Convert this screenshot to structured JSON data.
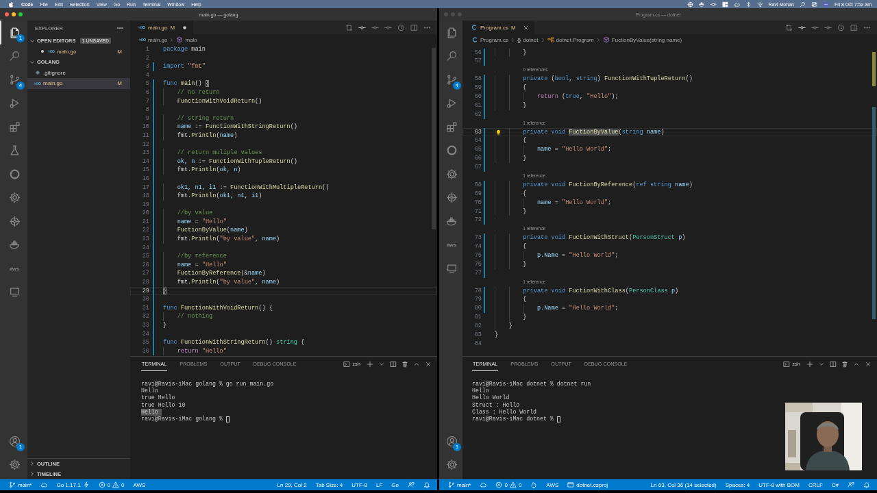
{
  "menubar": {
    "app": "Code",
    "menus": [
      "File",
      "Edit",
      "Selection",
      "View",
      "Go",
      "Run",
      "Terminal",
      "Window",
      "Help"
    ],
    "user": "Ravi Mohan",
    "clock": "Fri 8 Oct 7:52 am"
  },
  "windows": [
    {
      "title": "main.go — golang",
      "active": true,
      "activity": [
        {
          "kind": "files",
          "selected": true,
          "badge": "1"
        },
        {
          "kind": "search",
          "selected": false
        },
        {
          "kind": "scm",
          "selected": false,
          "badge": "4"
        },
        {
          "kind": "debug",
          "selected": false
        },
        {
          "kind": "extensions",
          "selected": false
        },
        {
          "kind": "flask",
          "selected": false
        },
        {
          "kind": "ring",
          "selected": false
        },
        {
          "kind": "gear",
          "selected": false
        },
        {
          "kind": "helm",
          "selected": false
        },
        {
          "kind": "whale",
          "selected": false
        },
        {
          "kind": "aws",
          "label": "aws",
          "selected": false
        },
        {
          "kind": "monitor",
          "selected": false
        }
      ],
      "activity_bottom": [
        {
          "kind": "account",
          "selected": false,
          "badge": "1"
        },
        {
          "kind": "settings",
          "selected": false
        }
      ],
      "sidebar": {
        "title": "EXPLORER",
        "sections": [
          {
            "title": "OPEN EDITORS",
            "expanded": true,
            "badge": "1 UNSAVED",
            "items": [
              {
                "name": "main.go",
                "kind": "go-file",
                "git_status": "M",
                "dirty": true,
                "selected": false
              }
            ]
          },
          {
            "title": "GOLANG",
            "expanded": true,
            "items": [
              {
                "name": ".gitignore",
                "kind": "gitignore",
                "selected": false
              },
              {
                "name": "main.go",
                "kind": "go-file",
                "git_status": "M",
                "selected": true
              }
            ]
          },
          {
            "title": "OUTLINE",
            "expanded": false
          },
          {
            "title": "TIMELINE",
            "expanded": false
          }
        ]
      },
      "editor": {
        "tabs": [
          {
            "label": "main.go",
            "kind": "go-file",
            "git_status": "M",
            "dirty": true,
            "selected": true
          }
        ],
        "breadcrumbs": [
          {
            "kind": "go-file",
            "text": "main.go"
          },
          {
            "kind": "method",
            "text": "main"
          }
        ],
        "lines": [
          {
            "number": "1",
            "changed": false,
            "current": false,
            "tokens": [
              {
                "text": "package",
                "kind": "kw"
              },
              {
                "text": " main",
                "kind": "plain"
              }
            ]
          },
          {
            "number": "2",
            "changed": false,
            "current": false
          },
          {
            "number": "3",
            "changed": true,
            "current": false,
            "tokens": [
              {
                "text": "import",
                "kind": "kw"
              },
              {
                "text": " \"fmt\"",
                "kind": "str"
              }
            ]
          },
          {
            "number": "4",
            "changed": false,
            "current": false
          },
          {
            "number": "5",
            "changed": true,
            "current": false,
            "tokens": [
              {
                "text": "func",
                "kind": "kw"
              },
              {
                "text": " main",
                "kind": "fn"
              },
              {
                "text": "() ",
                "kind": "plain"
              },
              {
                "text": "{",
                "kind": "brace"
              }
            ]
          },
          {
            "number": "6",
            "changed": true,
            "current": false,
            "tokens": [
              {
                "text": "    // no return",
                "kind": "com"
              }
            ]
          },
          {
            "number": "7",
            "changed": true,
            "current": false,
            "tokens": [
              {
                "text": "    FunctionWithVoidReturn",
                "kind": "fn"
              },
              {
                "text": "()",
                "kind": "plain"
              }
            ]
          },
          {
            "number": "8",
            "changed": true,
            "current": false
          },
          {
            "number": "9",
            "changed": true,
            "current": false,
            "tokens": [
              {
                "text": "    // string return",
                "kind": "com"
              }
            ]
          },
          {
            "number": "10",
            "changed": true,
            "current": false,
            "tokens": [
              {
                "text": "    name",
                "kind": "var"
              },
              {
                "text": " := ",
                "kind": "plain"
              },
              {
                "text": "FunctionWithStringReturn",
                "kind": "fn"
              },
              {
                "text": "()",
                "kind": "plain"
              }
            ]
          },
          {
            "number": "11",
            "changed": true,
            "current": false,
            "tokens": [
              {
                "text": "    fmt.",
                "kind": "plain"
              },
              {
                "text": "Println",
                "kind": "fn"
              },
              {
                "text": "(",
                "kind": "plain"
              },
              {
                "text": "name",
                "kind": "var"
              },
              {
                "text": ")",
                "kind": "plain"
              }
            ]
          },
          {
            "number": "12",
            "changed": true,
            "current": false
          },
          {
            "number": "13",
            "changed": true,
            "current": false,
            "tokens": [
              {
                "text": "    // return muliple values",
                "kind": "com"
              }
            ]
          },
          {
            "number": "14",
            "changed": true,
            "current": false,
            "tokens": [
              {
                "text": "    ok, n",
                "kind": "var"
              },
              {
                "text": " := ",
                "kind": "plain"
              },
              {
                "text": "FunctionWithTupleReturn",
                "kind": "fn"
              },
              {
                "text": "()",
                "kind": "plain"
              }
            ]
          },
          {
            "number": "15",
            "changed": true,
            "current": false,
            "tokens": [
              {
                "text": "    fmt.",
                "kind": "plain"
              },
              {
                "text": "Println",
                "kind": "fn"
              },
              {
                "text": "(",
                "kind": "plain"
              },
              {
                "text": "ok, n",
                "kind": "var"
              },
              {
                "text": ")",
                "kind": "plain"
              }
            ]
          },
          {
            "number": "16",
            "changed": true,
            "current": false
          },
          {
            "number": "17",
            "changed": true,
            "current": false,
            "tokens": [
              {
                "text": "    ok1, n1, i1",
                "kind": "var"
              },
              {
                "text": " := ",
                "kind": "plain"
              },
              {
                "text": "FunctionWithMultipleReturn",
                "kind": "fn"
              },
              {
                "text": "()",
                "kind": "plain"
              }
            ]
          },
          {
            "number": "18",
            "changed": true,
            "current": false,
            "tokens": [
              {
                "text": "    fmt.",
                "kind": "plain"
              },
              {
                "text": "Println",
                "kind": "fn"
              },
              {
                "text": "(",
                "kind": "plain"
              },
              {
                "text": "ok1, n1, i1",
                "kind": "var"
              },
              {
                "text": ")",
                "kind": "plain"
              }
            ]
          },
          {
            "number": "19",
            "changed": true,
            "current": false
          },
          {
            "number": "20",
            "changed": true,
            "current": false,
            "tokens": [
              {
                "text": "    //by value",
                "kind": "com"
              }
            ]
          },
          {
            "number": "21",
            "changed": true,
            "current": false,
            "tokens": [
              {
                "text": "    name",
                "kind": "var"
              },
              {
                "text": " = ",
                "kind": "plain"
              },
              {
                "text": "\"Hello\"",
                "kind": "str"
              }
            ]
          },
          {
            "number": "22",
            "changed": true,
            "current": false,
            "tokens": [
              {
                "text": "    FuctionByValue",
                "kind": "fn"
              },
              {
                "text": "(",
                "kind": "plain"
              },
              {
                "text": "name",
                "kind": "var"
              },
              {
                "text": ")",
                "kind": "plain"
              }
            ]
          },
          {
            "number": "23",
            "changed": true,
            "current": false,
            "tokens": [
              {
                "text": "    fmt.",
                "kind": "plain"
              },
              {
                "text": "Println",
                "kind": "fn"
              },
              {
                "text": "(",
                "kind": "plain"
              },
              {
                "text": "\"by value\"",
                "kind": "str"
              },
              {
                "text": ", ",
                "kind": "plain"
              },
              {
                "text": "name",
                "kind": "var"
              },
              {
                "text": ")",
                "kind": "plain"
              }
            ]
          },
          {
            "number": "24",
            "changed": true,
            "current": false
          },
          {
            "number": "25",
            "changed": true,
            "current": false,
            "tokens": [
              {
                "text": "    //by reference",
                "kind": "com"
              }
            ]
          },
          {
            "number": "26",
            "changed": true,
            "current": false,
            "tokens": [
              {
                "text": "    name",
                "kind": "var"
              },
              {
                "text": " = ",
                "kind": "plain"
              },
              {
                "text": "\"Hello\"",
                "kind": "str"
              }
            ]
          },
          {
            "number": "27",
            "changed": true,
            "current": false,
            "tokens": [
              {
                "text": "    FuctionByReference",
                "kind": "fn"
              },
              {
                "text": "(&",
                "kind": "plain"
              },
              {
                "text": "name",
                "kind": "var"
              },
              {
                "text": ")",
                "kind": "plain"
              }
            ]
          },
          {
            "number": "28",
            "changed": true,
            "current": false,
            "tokens": [
              {
                "text": "    fmt.",
                "kind": "plain"
              },
              {
                "text": "Println",
                "kind": "fn"
              },
              {
                "text": "(",
                "kind": "plain"
              },
              {
                "text": "\"by value\"",
                "kind": "str"
              },
              {
                "text": ", ",
                "kind": "plain"
              },
              {
                "text": "name",
                "kind": "var"
              },
              {
                "text": ")",
                "kind": "plain"
              }
            ]
          },
          {
            "number": "29",
            "changed": true,
            "current": true,
            "tokens": [
              {
                "text": "}",
                "kind": "brace"
              }
            ]
          },
          {
            "number": "30",
            "changed": true,
            "current": false
          },
          {
            "number": "31",
            "changed": true,
            "current": false,
            "tokens": [
              {
                "text": "func",
                "kind": "kw"
              },
              {
                "text": " FunctionWithVoidReturn",
                "kind": "fn"
              },
              {
                "text": "() {",
                "kind": "plain"
              }
            ]
          },
          {
            "number": "32",
            "changed": true,
            "current": false,
            "tokens": [
              {
                "text": "    // nothing",
                "kind": "com"
              }
            ]
          },
          {
            "number": "33",
            "changed": true,
            "current": false,
            "tokens": [
              {
                "text": "}",
                "kind": "plain"
              }
            ]
          },
          {
            "number": "34",
            "changed": true,
            "current": false
          },
          {
            "number": "35",
            "changed": true,
            "current": false,
            "tokens": [
              {
                "text": "func",
                "kind": "kw"
              },
              {
                "text": " FunctionWithStringReturn",
                "kind": "fn"
              },
              {
                "text": "() ",
                "kind": "plain"
              },
              {
                "text": "string",
                "kind": "type"
              },
              {
                "text": " {",
                "kind": "plain"
              }
            ]
          },
          {
            "number": "36",
            "changed": true,
            "current": false,
            "tokens": [
              {
                "text": "    return",
                "kind": "ctl"
              },
              {
                "text": " \"Hello\"",
                "kind": "str"
              }
            ]
          }
        ]
      },
      "panel": {
        "tabs": [
          {
            "label": "TERMINAL",
            "selected": true
          },
          {
            "label": "PROBLEMS",
            "selected": false
          },
          {
            "label": "OUTPUT",
            "selected": false
          },
          {
            "label": "DEBUG CONSOLE",
            "selected": false
          }
        ],
        "shell": "zsh",
        "lines": [
          {
            "text": "ravi@Ravis-iMac golang % go run main.go",
            "selected": false,
            "cursor": false
          },
          {
            "text": "Hello",
            "selected": false,
            "cursor": false
          },
          {
            "text": "true Hello",
            "selected": false,
            "cursor": false
          },
          {
            "text": "true Hello 10",
            "selected": false,
            "cursor": false
          },
          {
            "text": "Hello",
            "selected": true,
            "cursor": false
          },
          {
            "text": "ravi@Ravis-iMac golang %",
            "selected": false,
            "cursor": true
          }
        ]
      },
      "status_bar": {
        "left": [
          {
            "kind": "branch",
            "text": "main*"
          },
          {
            "kind": "cloud"
          },
          {
            "kind": "go",
            "text": "Go 1.17.1"
          },
          {
            "kind": "problems",
            "errors": "0",
            "warnings": "0"
          },
          {
            "kind": "text",
            "text": "AWS"
          }
        ],
        "right": [
          {
            "kind": "text",
            "text": "Ln 29, Col 2"
          },
          {
            "kind": "text",
            "text": "Tab Size: 4"
          },
          {
            "kind": "text",
            "text": "UTF-8"
          },
          {
            "kind": "text",
            "text": "LF"
          },
          {
            "kind": "text",
            "text": "Go"
          },
          {
            "kind": "feedback"
          },
          {
            "kind": "bell"
          }
        ]
      }
    },
    {
      "title": "Program.cs — dotnet",
      "active": false,
      "activity": [
        {
          "kind": "files",
          "selected": false
        },
        {
          "kind": "search",
          "selected": false
        },
        {
          "kind": "scm",
          "selected": false,
          "badge": "4"
        },
        {
          "kind": "debug",
          "selected": false
        },
        {
          "kind": "extensions",
          "selected": false
        },
        {
          "kind": "ring",
          "selected": false
        },
        {
          "kind": "gear",
          "selected": false
        },
        {
          "kind": "helm",
          "selected": false
        },
        {
          "kind": "whale",
          "selected": false
        },
        {
          "kind": "aws",
          "label": "aws",
          "selected": false
        },
        {
          "kind": "monitor",
          "selected": false
        }
      ],
      "activity_bottom": [
        {
          "kind": "account",
          "selected": false,
          "badge": "1"
        },
        {
          "kind": "settings",
          "selected": false
        }
      ],
      "editor": {
        "tabs": [
          {
            "label": "Program.cs",
            "kind": "cs-file",
            "git_status": "M",
            "dirty": false,
            "selected": true
          }
        ],
        "breadcrumbs": [
          {
            "kind": "cs-file",
            "text": "Program.cs"
          },
          {
            "kind": "namespace",
            "symbol": "{}",
            "text": "dotnet"
          },
          {
            "kind": "class",
            "text": "dotnet.Program"
          },
          {
            "kind": "method",
            "text": "FuctionByValue(string name)"
          }
        ],
        "lightbulb": true,
        "lines": [
          {
            "number": "56",
            "changed": true,
            "current": false,
            "tokens": [
              {
                "text": "        }",
                "kind": "plain"
              }
            ]
          },
          {
            "number": "57",
            "changed": true,
            "current": false
          },
          {
            "number": "58",
            "changed": true,
            "current": false,
            "codelens": "0 references",
            "tokens": [
              {
                "text": "        private",
                "kind": "kw"
              },
              {
                "text": " (",
                "kind": "plain"
              },
              {
                "text": "bool",
                "kind": "kw"
              },
              {
                "text": ", ",
                "kind": "plain"
              },
              {
                "text": "string",
                "kind": "kw"
              },
              {
                "text": ") ",
                "kind": "plain"
              },
              {
                "text": "FunctionWithTupleReturn",
                "kind": "fn"
              },
              {
                "text": "()",
                "kind": "plain"
              }
            ]
          },
          {
            "number": "59",
            "changed": true,
            "current": false,
            "tokens": [
              {
                "text": "        {",
                "kind": "plain"
              }
            ]
          },
          {
            "number": "60",
            "changed": true,
            "current": false,
            "tokens": [
              {
                "text": "            return",
                "kind": "ctl"
              },
              {
                "text": " (",
                "kind": "plain"
              },
              {
                "text": "true",
                "kind": "kw"
              },
              {
                "text": ", ",
                "kind": "plain"
              },
              {
                "text": "\"Hello\"",
                "kind": "str"
              },
              {
                "text": ");",
                "kind": "plain"
              }
            ]
          },
          {
            "number": "61",
            "changed": true,
            "current": false,
            "tokens": [
              {
                "text": "        }",
                "kind": "plain"
              }
            ]
          },
          {
            "number": "62",
            "changed": true,
            "current": false
          },
          {
            "number": "63",
            "changed": true,
            "current": true,
            "codelens": "1 reference",
            "tokens": [
              {
                "text": "        private void ",
                "kind": "kw"
              },
              {
                "text": "FuctionByValue",
                "kind": "selfn"
              },
              {
                "text": "(",
                "kind": "plain"
              },
              {
                "text": "string",
                "kind": "kw"
              },
              {
                "text": " name",
                "kind": "var"
              },
              {
                "text": ")",
                "kind": "plain"
              }
            ]
          },
          {
            "number": "64",
            "changed": true,
            "current": false,
            "tokens": [
              {
                "text": "        {",
                "kind": "plain"
              }
            ]
          },
          {
            "number": "65",
            "changed": true,
            "current": false,
            "tokens": [
              {
                "text": "            name",
                "kind": "var"
              },
              {
                "text": " = ",
                "kind": "plain"
              },
              {
                "text": "\"Hello World\"",
                "kind": "str"
              },
              {
                "text": ";",
                "kind": "plain"
              }
            ]
          },
          {
            "number": "66",
            "changed": true,
            "current": false,
            "tokens": [
              {
                "text": "        }",
                "kind": "plain"
              }
            ]
          },
          {
            "number": "67",
            "changed": true,
            "current": false
          },
          {
            "number": "68",
            "changed": true,
            "current": false,
            "codelens": "1 reference",
            "tokens": [
              {
                "text": "        private void",
                "kind": "kw"
              },
              {
                "text": " FuctionByReference",
                "kind": "fn"
              },
              {
                "text": "(",
                "kind": "plain"
              },
              {
                "text": "ref string",
                "kind": "kw"
              },
              {
                "text": " name",
                "kind": "var"
              },
              {
                "text": ")",
                "kind": "plain"
              }
            ]
          },
          {
            "number": "69",
            "changed": true,
            "current": false,
            "tokens": [
              {
                "text": "        {",
                "kind": "plain"
              }
            ]
          },
          {
            "number": "70",
            "changed": true,
            "current": false,
            "tokens": [
              {
                "text": "            name",
                "kind": "var"
              },
              {
                "text": " = ",
                "kind": "plain"
              },
              {
                "text": "\"Hello World\"",
                "kind": "str"
              },
              {
                "text": ";",
                "kind": "plain"
              }
            ]
          },
          {
            "number": "71",
            "changed": true,
            "current": false,
            "tokens": [
              {
                "text": "        }",
                "kind": "plain"
              }
            ]
          },
          {
            "number": "72",
            "changed": true,
            "current": false
          },
          {
            "number": "73",
            "changed": true,
            "current": false,
            "codelens": "1 reference",
            "tokens": [
              {
                "text": "        private void",
                "kind": "kw"
              },
              {
                "text": " FuctionWithStruct",
                "kind": "fn"
              },
              {
                "text": "(",
                "kind": "plain"
              },
              {
                "text": "PersonStruct",
                "kind": "type"
              },
              {
                "text": " p",
                "kind": "var"
              },
              {
                "text": ")",
                "kind": "plain"
              }
            ]
          },
          {
            "number": "74",
            "changed": true,
            "current": false,
            "tokens": [
              {
                "text": "        {",
                "kind": "plain"
              }
            ]
          },
          {
            "number": "75",
            "changed": true,
            "current": false,
            "tokens": [
              {
                "text": "            p.Name",
                "kind": "var"
              },
              {
                "text": " = ",
                "kind": "plain"
              },
              {
                "text": "\"Hello World\"",
                "kind": "str"
              },
              {
                "text": ";",
                "kind": "plain"
              }
            ]
          },
          {
            "number": "76",
            "changed": true,
            "current": false,
            "tokens": [
              {
                "text": "        }",
                "kind": "plain"
              }
            ]
          },
          {
            "number": "77",
            "changed": true,
            "current": false
          },
          {
            "number": "78",
            "changed": true,
            "current": false,
            "codelens": "1 reference",
            "tokens": [
              {
                "text": "        private void",
                "kind": "kw"
              },
              {
                "text": " FuctionWithClass",
                "kind": "fn"
              },
              {
                "text": "(",
                "kind": "plain"
              },
              {
                "text": "PersonClass",
                "kind": "type"
              },
              {
                "text": " p",
                "kind": "var"
              },
              {
                "text": ")",
                "kind": "plain"
              }
            ]
          },
          {
            "number": "79",
            "changed": true,
            "current": false,
            "tokens": [
              {
                "text": "        {",
                "kind": "plain"
              }
            ]
          },
          {
            "number": "80",
            "changed": true,
            "current": false,
            "tokens": [
              {
                "text": "            p.Name",
                "kind": "var"
              },
              {
                "text": " = ",
                "kind": "plain"
              },
              {
                "text": "\"Hello World\"",
                "kind": "str"
              },
              {
                "text": ";",
                "kind": "plain"
              }
            ]
          },
          {
            "number": "81",
            "changed": false,
            "current": false,
            "tokens": [
              {
                "text": "        }",
                "kind": "plain"
              }
            ]
          },
          {
            "number": "82",
            "changed": false,
            "current": false,
            "tokens": [
              {
                "text": "    }",
                "kind": "plain"
              }
            ]
          },
          {
            "number": "83",
            "changed": false,
            "current": false,
            "tokens": [
              {
                "text": "}",
                "kind": "plain"
              }
            ]
          },
          {
            "number": "84",
            "changed": false,
            "current": false
          }
        ]
      },
      "panel": {
        "tabs": [
          {
            "label": "TERMINAL",
            "selected": true
          },
          {
            "label": "PROBLEMS",
            "selected": false
          },
          {
            "label": "OUTPUT",
            "selected": false
          },
          {
            "label": "DEBUG CONSOLE",
            "selected": false
          }
        ],
        "shell": "zsh",
        "lines": [
          {
            "text": "ravi@Ravis-iMac dotnet % dotnet run",
            "selected": false,
            "cursor": false
          },
          {
            "text": "Hello",
            "selected": false,
            "cursor": false
          },
          {
            "text": "Hello World",
            "selected": false,
            "cursor": false
          },
          {
            "text": "Struct : Hello",
            "selected": false,
            "cursor": false
          },
          {
            "text": "Class : Hello World",
            "selected": false,
            "cursor": false
          },
          {
            "text": "ravi@Ravis-iMac dotnet %",
            "selected": false,
            "cursor": true
          }
        ]
      },
      "status_bar": {
        "left": [
          {
            "kind": "branch",
            "text": "main*"
          },
          {
            "kind": "cloud"
          },
          {
            "kind": "problems",
            "errors": "0",
            "warnings": "0"
          },
          {
            "kind": "flame"
          },
          {
            "kind": "text",
            "text": "AWS"
          },
          {
            "kind": "project",
            "text": "dotnet.csproj"
          }
        ],
        "right": [
          {
            "kind": "text",
            "text": "Ln 63, Col 36 (14 selected)"
          },
          {
            "kind": "text",
            "text": "Spaces: 4"
          },
          {
            "kind": "text",
            "text": "UTF-8 with BOM"
          },
          {
            "kind": "text",
            "text": "CRLF"
          },
          {
            "kind": "text",
            "text": "C#"
          },
          {
            "kind": "feedback"
          },
          {
            "kind": "bell"
          }
        ]
      }
    }
  ]
}
